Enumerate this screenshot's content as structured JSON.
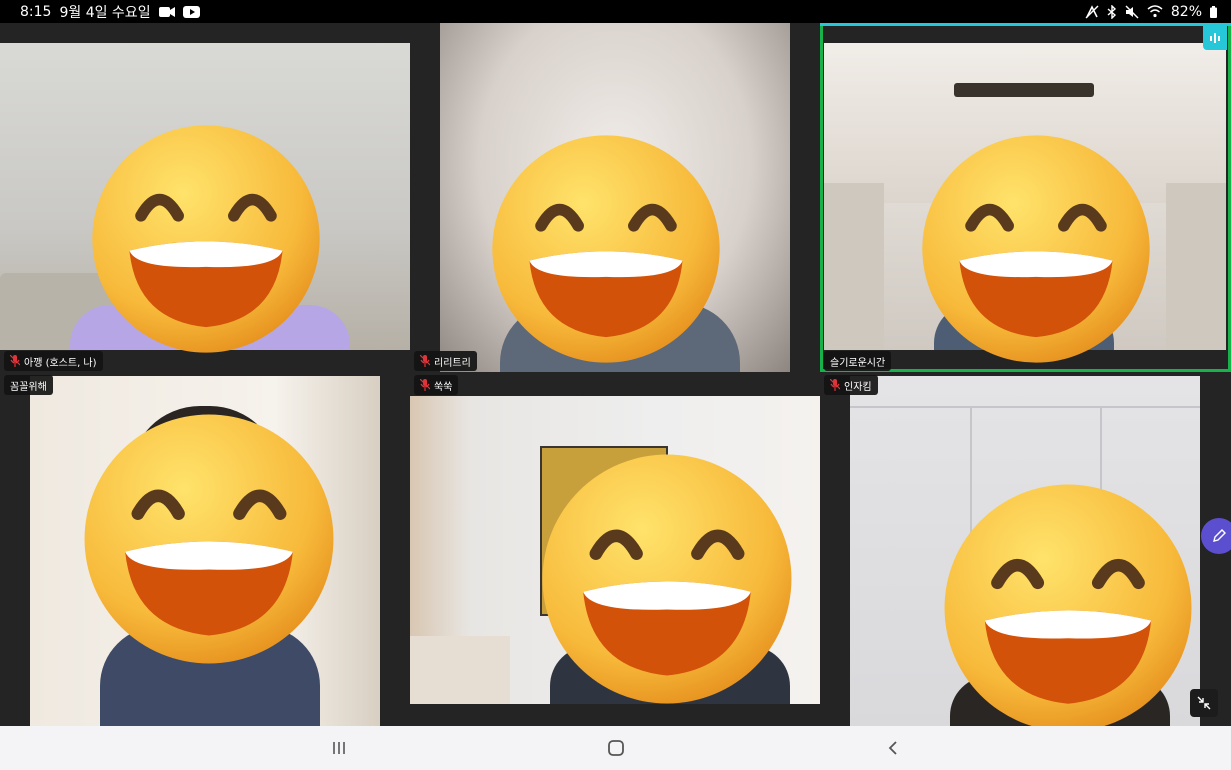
{
  "status_bar": {
    "time": "8:15",
    "date": "9월 4일 수요일",
    "battery": "82%",
    "left_icons": [
      "video-camera-icon",
      "youtube-icon"
    ],
    "right_icons": [
      "nfc-icon",
      "bluetooth-icon",
      "mute-icon",
      "wifi-icon",
      "battery-icon"
    ]
  },
  "participants": [
    {
      "name": "아깽 (호스트, 나)",
      "muted": true
    },
    {
      "name": "리리트리",
      "muted": true
    },
    {
      "name": "슬기로운시간",
      "muted": false,
      "active_speaker": true
    },
    {
      "name": "꼼꼴위해",
      "muted": false
    },
    {
      "name": "쑥쑥",
      "muted": true
    },
    {
      "name": "인자킴",
      "muted": true
    }
  ],
  "colors": {
    "active_border": "#19b24a",
    "active_top": "#25c7d9",
    "mute_icon": "#e0343a",
    "floating_pen_button": "#5b4fcf"
  },
  "nav_bar": {
    "buttons": [
      "recent-apps-icon",
      "home-icon",
      "back-icon"
    ]
  }
}
